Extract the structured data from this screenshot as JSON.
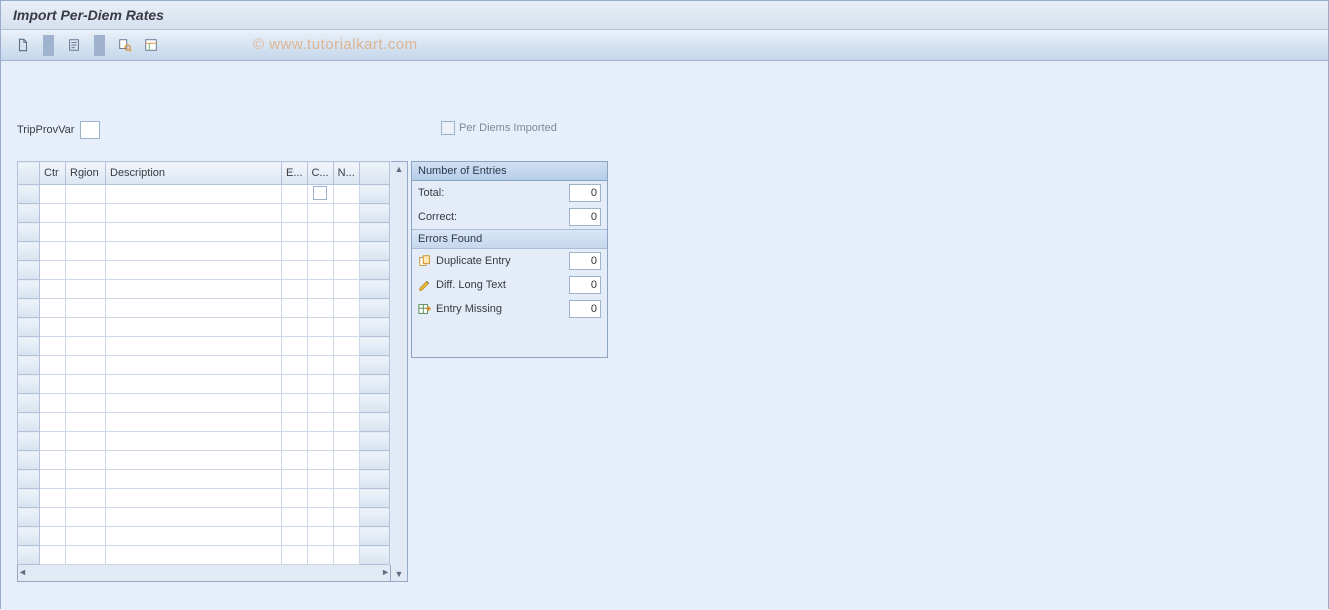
{
  "title": "Import Per-Diem Rates",
  "watermark": "© www.tutorialkart.com",
  "toolbar": {
    "new": "document-new",
    "log": "document-log",
    "preview": "print-preview",
    "layout": "layout"
  },
  "fields": {
    "tripProvVar_label": "TripProvVar",
    "tripProvVar_value": "",
    "perDiemsImported_label": "Per Diems Imported",
    "perDiemsImported_checked": false
  },
  "table": {
    "columns": {
      "ctr": "Ctr",
      "rgion": "Rgion",
      "description": "Description",
      "e": "E...",
      "c": "C...",
      "n": "N..."
    },
    "rowCount": 20
  },
  "panel": {
    "title": "Number of Entries",
    "total_label": "Total:",
    "total_value": "0",
    "correct_label": "Correct:",
    "correct_value": "0",
    "errors_title": "Errors Found",
    "dup_label": "Duplicate Entry",
    "dup_value": "0",
    "diff_label": "Diff. Long Text",
    "diff_value": "0",
    "miss_label": "Entry Missing",
    "miss_value": "0"
  }
}
